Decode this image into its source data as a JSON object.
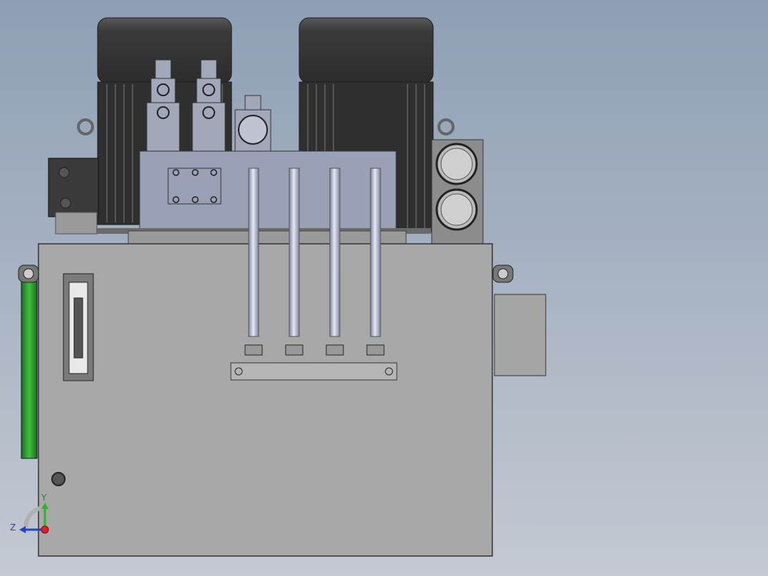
{
  "viewport": {
    "background_top": "#8e9fb5",
    "background_bottom": "#c4c9d2"
  },
  "triad": {
    "y_label": "Y",
    "z_label": "Z",
    "x_color": "#e0202a",
    "y_color": "#2cb52c",
    "z_color": "#1f3fd6"
  },
  "model": {
    "tank_color": "#a8a8a8",
    "motor_color": "#3d3d3d",
    "manifold_color": "#9aa0b5",
    "pipe_color": "#b8bfd6",
    "accent_green": "#2a9a2a"
  }
}
